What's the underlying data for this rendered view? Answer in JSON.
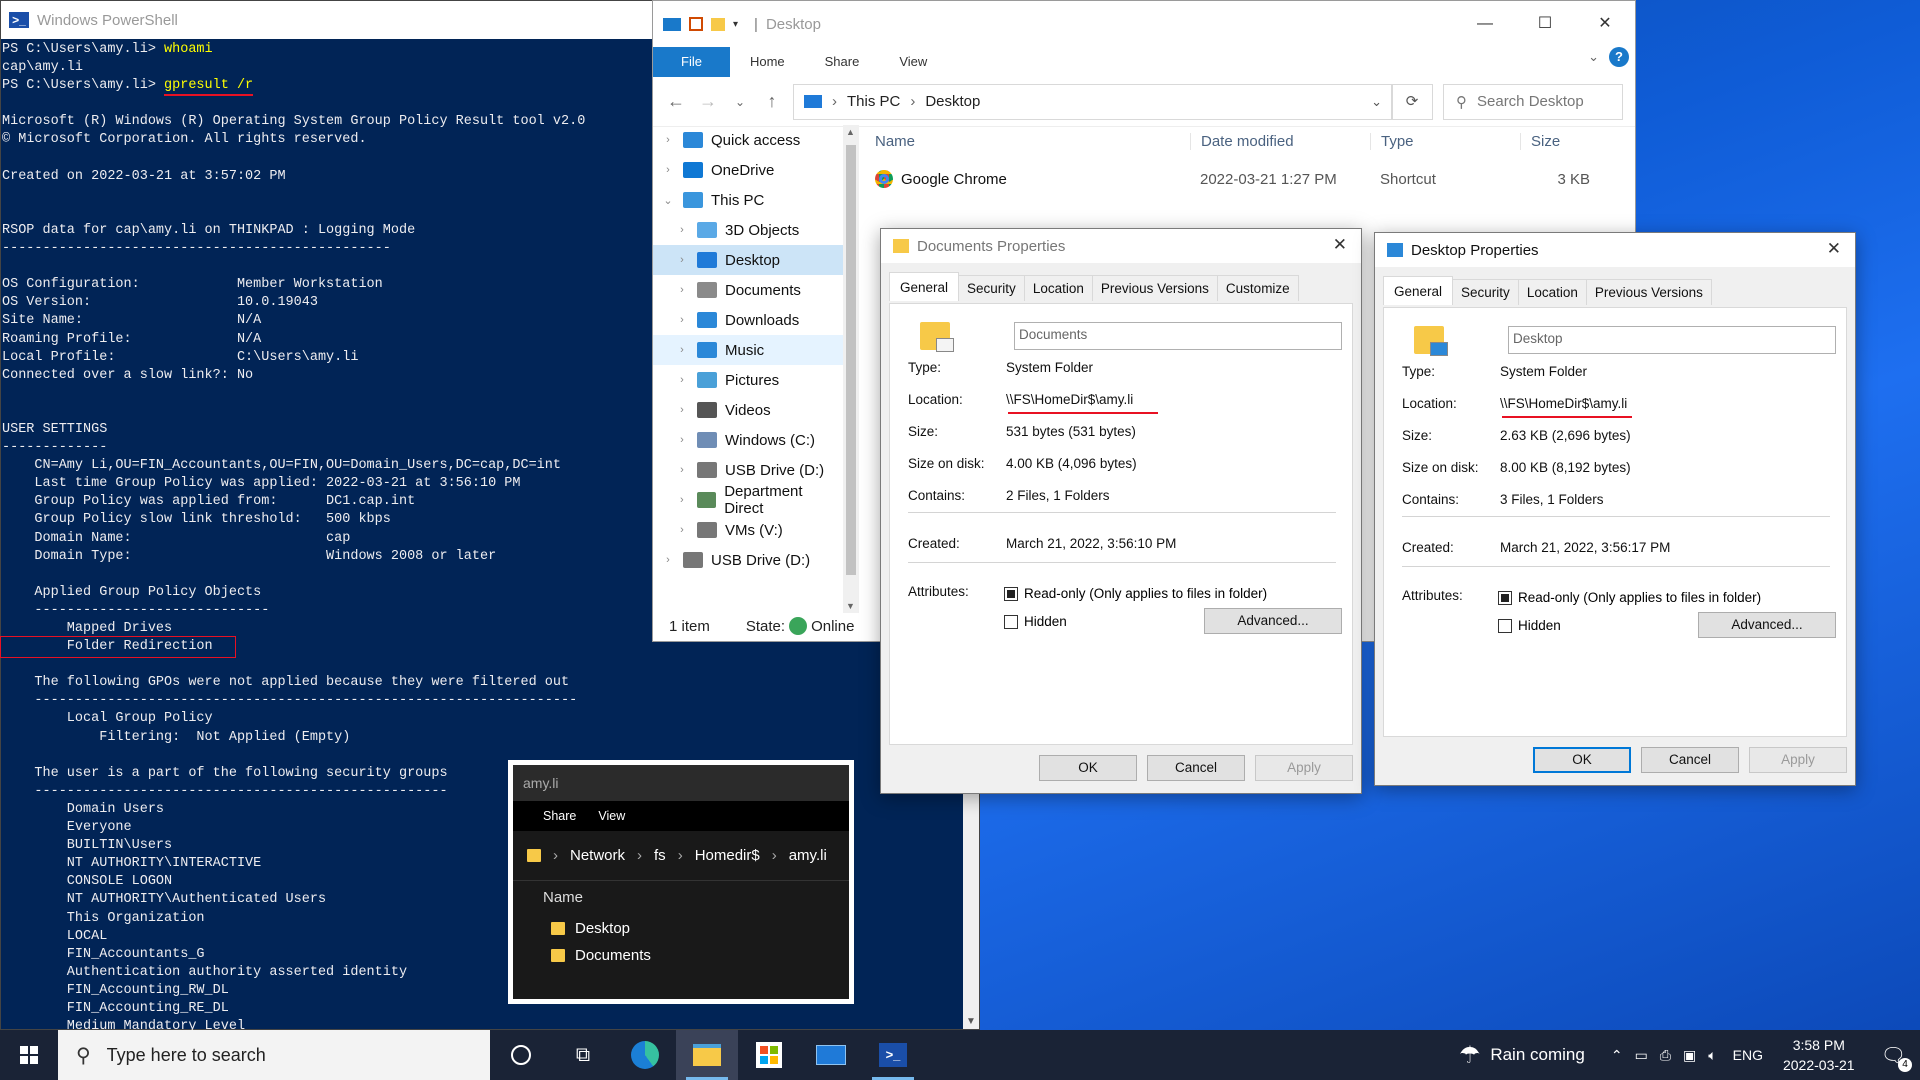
{
  "powershell": {
    "title": "Windows PowerShell",
    "lines": [
      {
        "p": "PS C:\\Users\\amy.li> ",
        "c": "whoami"
      },
      {
        "t": "cap\\amy.li"
      },
      {
        "p": "PS C:\\Users\\amy.li> ",
        "c": "gpresult /r",
        "u": true
      },
      {
        "t": ""
      },
      {
        "t": "Microsoft (R) Windows (R) Operating System Group Policy Result tool v2.0"
      },
      {
        "t": "© Microsoft Corporation. All rights reserved."
      },
      {
        "t": ""
      },
      {
        "t": "Created on ‎2022-‎03-‎21 at 3:57:02 PM"
      },
      {
        "t": ""
      },
      {
        "t": ""
      },
      {
        "t": "RSOP data for cap\\amy.li on THINKPAD : Logging Mode"
      },
      {
        "t": "------------------------------------------------"
      },
      {
        "t": ""
      },
      {
        "t": "OS Configuration:            Member Workstation"
      },
      {
        "t": "OS Version:                  10.0.19043"
      },
      {
        "t": "Site Name:                   N/A"
      },
      {
        "t": "Roaming Profile:             N/A"
      },
      {
        "t": "Local Profile:               C:\\Users\\amy.li"
      },
      {
        "t": "Connected over a slow link?: No"
      },
      {
        "t": ""
      },
      {
        "t": ""
      },
      {
        "t": "USER SETTINGS"
      },
      {
        "t": "-------------"
      },
      {
        "t": "    CN=Amy Li,OU=FIN_Accountants,OU=FIN,OU=Domain_Users,DC=cap,DC=int"
      },
      {
        "t": "    Last time Group Policy was applied: 2022-03-21 at 3:56:10 PM"
      },
      {
        "t": "    Group Policy was applied from:      DC1.cap.int"
      },
      {
        "t": "    Group Policy slow link threshold:   500 kbps"
      },
      {
        "t": "    Domain Name:                        cap"
      },
      {
        "t": "    Domain Type:                        Windows 2008 or later"
      },
      {
        "t": ""
      },
      {
        "t": "    Applied Group Policy Objects"
      },
      {
        "t": "    -----------------------------"
      },
      {
        "t": "        Mapped Drives"
      },
      {
        "t": "        Folder Redirection",
        "b": true
      },
      {
        "t": ""
      },
      {
        "t": "    The following GPOs were not applied because they were filtered out"
      },
      {
        "t": "    -------------------------------------------------------------------"
      },
      {
        "t": "        Local Group Policy"
      },
      {
        "t": "            Filtering:  Not Applied (Empty)"
      },
      {
        "t": ""
      },
      {
        "t": "    The user is a part of the following security groups"
      },
      {
        "t": "    ---------------------------------------------------"
      },
      {
        "t": "        Domain Users"
      },
      {
        "t": "        Everyone"
      },
      {
        "t": "        BUILTIN\\Users"
      },
      {
        "t": "        NT AUTHORITY\\INTERACTIVE"
      },
      {
        "t": "        CONSOLE LOGON"
      },
      {
        "t": "        NT AUTHORITY\\Authenticated Users"
      },
      {
        "t": "        This Organization"
      },
      {
        "t": "        LOCAL"
      },
      {
        "t": "        FIN_Accountants_G"
      },
      {
        "t": "        Authentication authority asserted identity"
      },
      {
        "t": "        FIN_Accounting_RW_DL"
      },
      {
        "t": "        FIN_Accounting_RE_DL"
      },
      {
        "t": "        Medium Mandatory Level"
      }
    ]
  },
  "explorer": {
    "title": "Desktop",
    "ribbon_tabs": [
      "File",
      "Home",
      "Share",
      "View"
    ],
    "path": [
      "This PC",
      "Desktop"
    ],
    "search_placeholder": "Search Desktop",
    "nav": [
      {
        "label": "Quick access",
        "icon": "star-icon",
        "color": "#2b88d8",
        "chev": "›",
        "indent": 0
      },
      {
        "label": "OneDrive",
        "icon": "cloud-icon",
        "color": "#0f78d4",
        "chev": "›",
        "indent": 0
      },
      {
        "label": "This PC",
        "icon": "computer-icon",
        "color": "#3a96dd",
        "chev": "⌄",
        "indent": 0
      },
      {
        "label": "3D Objects",
        "icon": "cube-icon",
        "color": "#5aa9e6",
        "chev": "›",
        "indent": 1
      },
      {
        "label": "Desktop",
        "icon": "desktop-folder-icon",
        "color": "#1f7ad8",
        "chev": "›",
        "indent": 1,
        "sel": true
      },
      {
        "label": "Documents",
        "icon": "documents-icon",
        "color": "#8a8a8a",
        "chev": "›",
        "indent": 1
      },
      {
        "label": "Downloads",
        "icon": "download-icon",
        "color": "#2b88d8",
        "chev": "›",
        "indent": 1
      },
      {
        "label": "Music",
        "icon": "music-icon",
        "color": "#2b88d8",
        "chev": "›",
        "indent": 1,
        "hov": true
      },
      {
        "label": "Pictures",
        "icon": "pictures-icon",
        "color": "#4aa0d8",
        "chev": "›",
        "indent": 1
      },
      {
        "label": "Videos",
        "icon": "videos-icon",
        "color": "#555",
        "chev": "›",
        "indent": 1
      },
      {
        "label": "Windows (C:)",
        "icon": "drive-icon",
        "color": "#6f8db5",
        "chev": "›",
        "indent": 1
      },
      {
        "label": "USB Drive (D:)",
        "icon": "usb-drive-icon",
        "color": "#777",
        "chev": "›",
        "indent": 1
      },
      {
        "label": "Department Direct",
        "icon": "network-drive-icon",
        "color": "#5a8a5a",
        "chev": "›",
        "indent": 1
      },
      {
        "label": "VMs (V:)",
        "icon": "network-drive-icon",
        "color": "#777",
        "chev": "›",
        "indent": 1
      },
      {
        "label": "USB Drive (D:)",
        "icon": "usb-drive-icon",
        "color": "#777",
        "chev": "›",
        "indent": 0
      }
    ],
    "columns": [
      "Name",
      "Date modified",
      "Type",
      "Size"
    ],
    "files": [
      {
        "name": "Google Chrome",
        "date": "2022-03-21 1:27 PM",
        "type": "Shortcut",
        "size": "3 KB"
      }
    ],
    "status": {
      "count": "1 item",
      "state_label": "State:",
      "state_value": "Online"
    }
  },
  "documents_props": {
    "title": "Documents Properties",
    "tabs": [
      "General",
      "Security",
      "Location",
      "Previous Versions",
      "Customize"
    ],
    "name": "Documents",
    "type_label": "Type:",
    "type": "System Folder",
    "location_label": "Location:",
    "location": "\\\\FS\\HomeDir$\\amy.li",
    "size_label": "Size:",
    "size": "531 bytes (531 bytes)",
    "sizeondisk_label": "Size on disk:",
    "sizeondisk": "4.00 KB (4,096 bytes)",
    "contains_label": "Contains:",
    "contains": "2 Files, 1 Folders",
    "created_label": "Created:",
    "created": "March 21, 2022, 3:56:10 PM",
    "attributes_label": "Attributes:",
    "readonly": "Read-only (Only applies to files in folder)",
    "hidden": "Hidden",
    "advanced": "Advanced...",
    "ok": "OK",
    "cancel": "Cancel",
    "apply": "Apply"
  },
  "desktop_props": {
    "title": "Desktop Properties",
    "tabs": [
      "General",
      "Security",
      "Location",
      "Previous Versions"
    ],
    "name": "Desktop",
    "type_label": "Type:",
    "type": "System Folder",
    "location_label": "Location:",
    "location": "\\\\FS\\HomeDir$\\amy.li",
    "size_label": "Size:",
    "size": "2.63 KB (2,696 bytes)",
    "sizeondisk_label": "Size on disk:",
    "sizeondisk": "8.00 KB (8,192 bytes)",
    "contains_label": "Contains:",
    "contains": "3 Files, 1 Folders",
    "created_label": "Created:",
    "created": "March 21, 2022, 3:56:17 PM",
    "attributes_label": "Attributes:",
    "readonly": "Read-only (Only applies to files in folder)",
    "hidden": "Hidden",
    "advanced": "Advanced...",
    "ok": "OK",
    "cancel": "Cancel",
    "apply": "Apply"
  },
  "amy_explorer": {
    "title": "amy.li",
    "ribbon": [
      "Share",
      "View"
    ],
    "path": [
      "Network",
      "fs",
      "Homedir$",
      "amy.li"
    ],
    "column": "Name",
    "items": [
      "Desktop",
      "Documents"
    ]
  },
  "taskbar": {
    "search_placeholder": "Type here to search",
    "weather": "Rain coming",
    "lang": "ENG",
    "time": "3:58 PM",
    "date": "2022-03-21",
    "notifications": "4"
  }
}
